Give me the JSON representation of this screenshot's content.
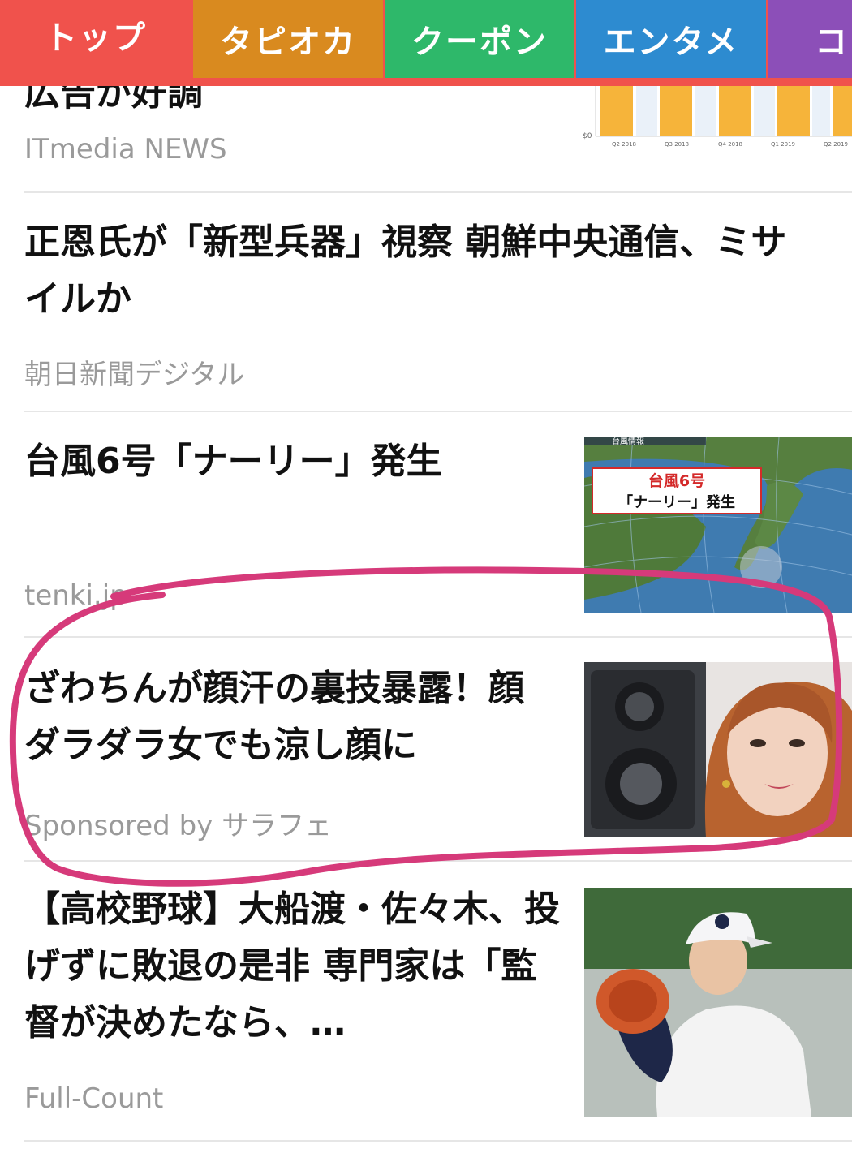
{
  "tabs": [
    {
      "label": "トップ",
      "color": "#f0524c"
    },
    {
      "label": "タピオカ",
      "color": "#d98a1f"
    },
    {
      "label": "クーポン",
      "color": "#2eb86a"
    },
    {
      "label": "エンタメ",
      "color": "#2d8bd0"
    },
    {
      "label": "コ",
      "color": "#8c4fb8"
    }
  ],
  "articles": [
    {
      "title": "広告が好調",
      "source": "ITmedia NEWS",
      "thumb_icon": "bar-chart-thumbnail",
      "chart_labels": {
        "y": "$0",
        "x": [
          "Q2 2018",
          "Q3 2018",
          "Q4 2018",
          "Q1 2019",
          "Q2 2019"
        ]
      }
    },
    {
      "title": "正恩氏が「新型兵器」視察 朝鮮中央通信、ミサイルか",
      "source": "朝日新聞デジタル"
    },
    {
      "title": "台風6号「ナーリー」発生",
      "source": "tenki.jp",
      "thumb_icon": "typhoon-map-thumbnail",
      "thumb_caption": {
        "header": "台風情報",
        "line1": "台風6号",
        "line2": "「ナーリー」発生"
      }
    },
    {
      "title": "ざわちんが顔汗の裏技暴露！顔ダラダラ女でも涼し顔に",
      "source": "Sponsored by サラフェ",
      "thumb_icon": "woman-portrait-thumbnail",
      "annotation_color": "#d63a7a"
    },
    {
      "title": "【高校野球】大船渡・佐々木、投げずに敗退の是非 専門家は「監督が決めたなら、…",
      "source": "Full-Count",
      "thumb_icon": "baseball-pitcher-thumbnail"
    }
  ]
}
